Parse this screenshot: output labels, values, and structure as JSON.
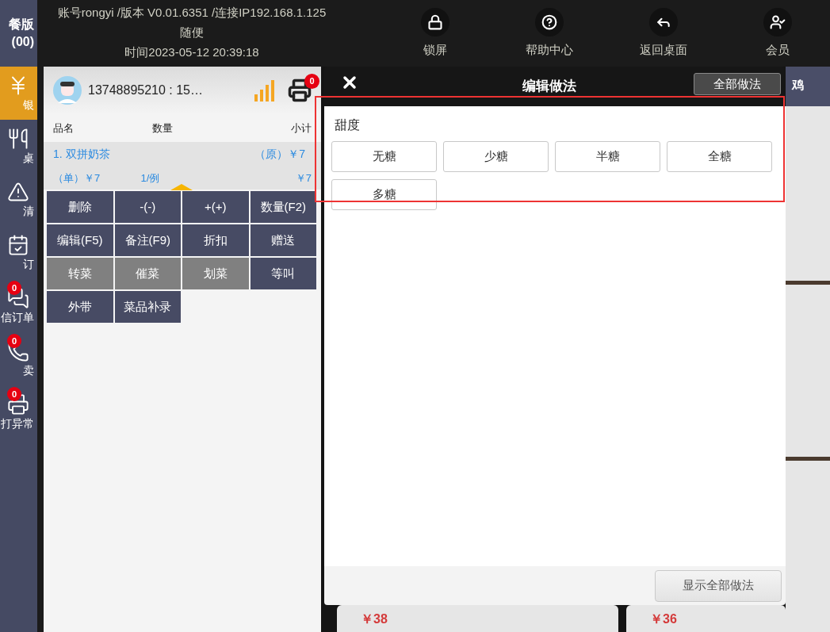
{
  "sidebar": {
    "header": [
      "餐版",
      "(00)"
    ],
    "items": [
      {
        "label": "银",
        "selected": true
      },
      {
        "label": "桌",
        "selected": false
      },
      {
        "label": "清",
        "selected": false
      },
      {
        "label": "订",
        "selected": false
      },
      {
        "label": "信订单",
        "selected": false,
        "badge": "0"
      },
      {
        "label": "卖",
        "selected": false,
        "badge": "0"
      },
      {
        "label": "打异常",
        "selected": false,
        "badge": "0"
      }
    ]
  },
  "header": {
    "info": "账号rongyi /版本 V0.01.6351 /连接IP192.168.1.125",
    "table": "随便",
    "time": "时间2023-05-12 20:39:18",
    "actions": [
      "锁屏",
      "帮助中心",
      "返回桌面",
      "会员"
    ]
  },
  "cart": {
    "user": "13748895210 : 15…",
    "printer_badge": "0",
    "columns": [
      "品名",
      "数量",
      "小计"
    ],
    "items": [
      {
        "name": "1. 双拼奶茶",
        "original_price": "（原）￥7",
        "unit_price": "（单）￥7",
        "quantity": "1/例",
        "subtotal": "￥7",
        "selected": true
      }
    ],
    "actions": [
      {
        "label": "删除",
        "disabled": false
      },
      {
        "label": "-(-)",
        "disabled": false
      },
      {
        "label": "+(+)",
        "disabled": false
      },
      {
        "label": "数量(F2)",
        "disabled": false
      },
      {
        "label": "编辑(F5)",
        "disabled": false
      },
      {
        "label": "备注(F9)",
        "disabled": false
      },
      {
        "label": "折扣",
        "disabled": false
      },
      {
        "label": "赠送",
        "disabled": false
      },
      {
        "label": "转菜",
        "disabled": true
      },
      {
        "label": "催菜",
        "disabled": true
      },
      {
        "label": "划菜",
        "disabled": true
      },
      {
        "label": "等叫",
        "disabled": false
      },
      {
        "label": "外带",
        "disabled": false
      },
      {
        "label": "菜品补录",
        "disabled": false
      }
    ]
  },
  "dialog": {
    "title": "编辑做法",
    "all_button": "全部做法",
    "groups": [
      {
        "name": "甜度",
        "options": [
          {
            "label": "无糖",
            "selected": false
          },
          {
            "label": "少糖",
            "selected": false
          },
          {
            "label": "半糖",
            "selected": false
          },
          {
            "label": "全糖",
            "selected": false
          },
          {
            "label": "多糖",
            "selected": false
          }
        ]
      }
    ],
    "footer_button": "显示全部做法"
  },
  "menu": {
    "category": "鸡",
    "prices": [
      "￥38",
      "￥36"
    ]
  }
}
